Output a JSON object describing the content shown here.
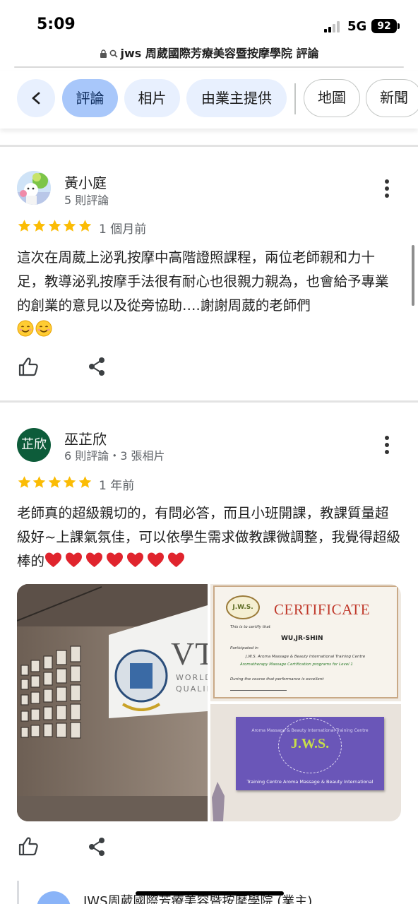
{
  "status_bar": {
    "time": "5:09",
    "network": "5G",
    "battery": "92"
  },
  "browser": {
    "url_text": "jws 周葳國際芳療美容暨按摩學院 評論"
  },
  "chips": {
    "reviews": "評論",
    "photos": "相片",
    "from_owner": "由業主提供",
    "map": "地圖",
    "news": "新聞"
  },
  "reviews": [
    {
      "name": "黃小庭",
      "meta": "5 則評論",
      "rating": 5,
      "time": "1 個月前",
      "text": "這次在周葳上泌乳按摩中高階證照課程，兩位老師親和力十足，教導泌乳按摩手法很有耐心也很親力親為，也會給予專業的創業的意見以及從旁協助….謝謝周葳的老師們",
      "emoji": "😊😊"
    },
    {
      "name": "巫芷欣",
      "avatar_initials": "芷欣",
      "meta": "6 則評論・3 張相片",
      "rating": 5,
      "time": "1 年前",
      "text": "老師真的超級親切的，有問必答，而且小班開課，教課質量超級好~上課氣氛佳，可以依學生需求做教課微調整，我覺得超級棒的",
      "emoji": "❤️❤️❤️❤️❤️❤️❤️"
    }
  ],
  "photos": {
    "wall_sign": "VT",
    "wall_sign_line1": "WORLD",
    "wall_sign_line2": "QUALIFI",
    "certificate_title": "CERTIFICATE",
    "certificate_logo": "J.W.S.",
    "certificate_name": "WU,JR-SHIN",
    "certificate_line1": "This is to certify that",
    "certificate_line2": "Participated in",
    "certificate_line3": "J.W.S. Aroma Massage & Beauty International Training Centre",
    "certificate_line4": "Aromatherapy Massage Certification programs for Level 1",
    "certificate_line5": "During the course that performance is excellent",
    "sign_logo": "J.W.S.",
    "sign_ring_text": "Aroma Massage & Beauty International Training Centre",
    "sign_bottom": "Training Centre Aroma Massage & Beauty International"
  },
  "owner_reply": {
    "name": "JWS周葳國際芳療美容暨按摩學院 (業主)"
  },
  "colors": {
    "chip_active": "#a8c7fa",
    "chip_filled": "#e8f0fe",
    "star": "#fbbc04",
    "avatar_green": "#0d5c3a"
  }
}
